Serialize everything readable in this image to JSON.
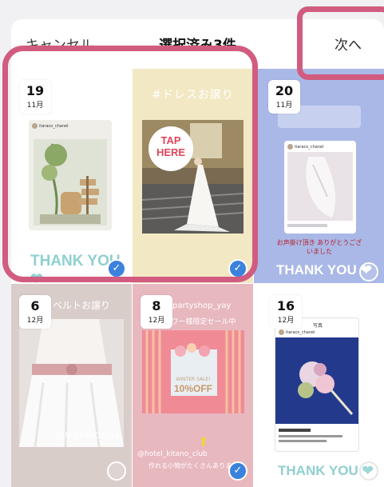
{
  "nav": {
    "cancel": "キャンセル",
    "title": "選択済み3件",
    "next": "次へ"
  },
  "items": [
    {
      "day": "19",
      "month": "11月",
      "selected": true,
      "caption": "THANK YOU ❤",
      "account": "itaraco_chanel"
    },
    {
      "selected": true,
      "heading": "#ドレスお譲り",
      "badge_line1": "TAP",
      "badge_line2": "HERE"
    },
    {
      "day": "20",
      "month": "11月",
      "selected": false,
      "caption": "THANK YOU ❤",
      "story_note": "お声掛け頂き ありがとうございました",
      "account": "itaraco_chanel"
    },
    {
      "day": "6",
      "month": "12月",
      "selected": false,
      "heading": "ュベルトお譲り",
      "watermark": "@MILKWO1104"
    },
    {
      "day": "8",
      "month": "12月",
      "selected": true,
      "heading": "partyshop_yay",
      "subheading": "フォロワー様限定セール中",
      "poster_line1": "WINTER SALE!",
      "poster_line2": "10%OFF",
      "tag": "@hotel_kitano_club",
      "note": "作れる小物がたくさんあります"
    },
    {
      "day": "16",
      "month": "12月",
      "selected": false,
      "caption": "THANK YOU ❤",
      "screen_title": "写真",
      "account": "itaraco_chanel"
    }
  ],
  "colors": {
    "accent_check": "#3b82dd",
    "highlight": "#d15c7f",
    "thank_you": "#8fd0cf"
  }
}
